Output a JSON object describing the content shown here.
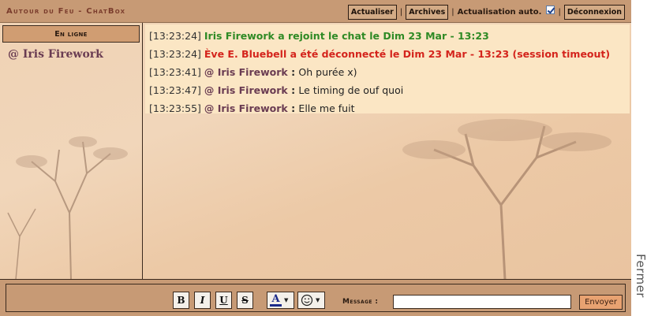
{
  "header": {
    "title": "Autour du Feu - ChatBox",
    "refresh_label": "Actualiser",
    "archives_label": "Archives",
    "auto_refresh_label": "Actualisation auto.",
    "auto_refresh_checked": true,
    "disconnect_label": "Déconnexion",
    "separator": "|"
  },
  "sidebar": {
    "online_header": "En ligne",
    "users": [
      "@ Iris Firework"
    ]
  },
  "messages": [
    {
      "time": "[13:23:24]",
      "type": "join",
      "text": "Iris Firework a rejoint le chat le Dim 23 Mar - 13:23"
    },
    {
      "time": "[13:23:24]",
      "type": "leave",
      "text": "Ève E. Bluebell a été déconnecté le Dim 23 Mar - 13:23 (session timeout)"
    },
    {
      "time": "[13:23:41]",
      "type": "chat",
      "author": "@ Iris Firework",
      "text": "Oh purée x)"
    },
    {
      "time": "[13:23:47]",
      "type": "chat",
      "author": "@ Iris Firework",
      "text": "Le timing de ouf quoi"
    },
    {
      "time": "[13:23:55]",
      "type": "chat",
      "author": "@ Iris Firework",
      "text": "Elle me fuit"
    }
  ],
  "input_bar": {
    "bold": "B",
    "italic": "I",
    "underline": "U",
    "strike": "S",
    "color_glyph": "A",
    "message_label": "Message :",
    "message_value": "",
    "send_label": "Envoyer"
  },
  "close_label": "Fermer",
  "colors": {
    "join": "#2f8a25",
    "leave": "#d4241c",
    "author": "#6a3c52",
    "header_bg": "#c79a75"
  },
  "icons": {
    "checkbox": "checkbox-checked-icon",
    "font_color": "font-color-icon",
    "emoji": "smiley-icon"
  }
}
